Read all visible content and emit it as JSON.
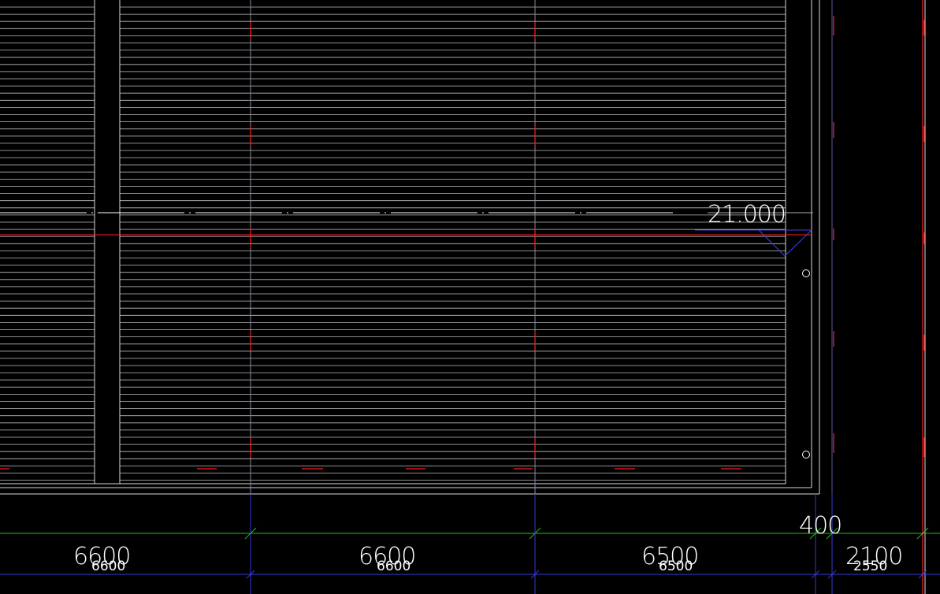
{
  "drawing": {
    "background": "#000000",
    "colors": {
      "grid_line": "#d8d8d8",
      "axis_red": "#ff2020",
      "dim_green": "#20c020",
      "dim_blue": "#3838d8",
      "elevation_symbol": "#4040e0",
      "text": "#ffffff"
    }
  },
  "elevation_marker": {
    "value": "21.000"
  },
  "dimensions": {
    "upper_row": [
      "6600",
      "6600",
      "6500",
      "400",
      "2100"
    ],
    "lower_row": [
      "6600",
      "6600",
      "6500",
      "2550"
    ]
  }
}
